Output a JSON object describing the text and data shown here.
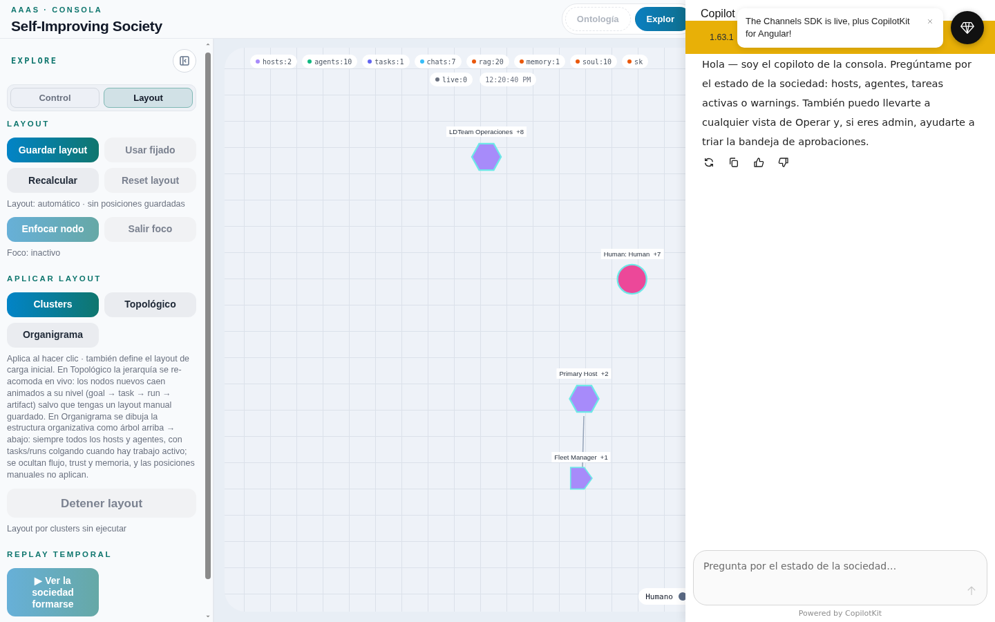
{
  "header": {
    "eyebrow": "AAAS · CONSOLA",
    "title": "Self-Improving Society"
  },
  "view_toggle": [
    {
      "label": "Ontología",
      "selected": false
    },
    {
      "label": "Explor",
      "selected": true
    }
  ],
  "sidebar": {
    "title": "EXPLORE",
    "tabs": [
      {
        "label": "Control",
        "selected": false
      },
      {
        "label": "Layout",
        "selected": true
      }
    ],
    "blocks": [
      {
        "kind": "heading",
        "text": "LAYOUT"
      },
      {
        "kind": "buttons",
        "items": [
          {
            "label": "Guardar layout",
            "kind": "primary"
          },
          {
            "label": "Usar fijado",
            "kind": "disabled"
          },
          {
            "label": "Recalcular",
            "kind": "default"
          },
          {
            "label": "Reset layout",
            "kind": "disabled"
          }
        ]
      },
      {
        "kind": "note",
        "text": "Layout: automático · sin posiciones guardadas"
      },
      {
        "kind": "buttons",
        "items": [
          {
            "label": "Enfocar nodo",
            "kind": "accent"
          },
          {
            "label": "Salir foco",
            "kind": "disabled"
          }
        ]
      },
      {
        "kind": "note",
        "text": "Foco: inactivo"
      },
      {
        "kind": "heading",
        "text": "APLICAR LAYOUT"
      },
      {
        "kind": "buttons",
        "items": [
          {
            "label": "Clusters",
            "kind": "primary"
          },
          {
            "label": "Topológico",
            "kind": "default"
          },
          {
            "label": "Organigrama",
            "kind": "default"
          }
        ]
      },
      {
        "kind": "note",
        "text": "Aplica al hacer clic · también define el layout de carga inicial. En Topológico la jerarquía se re-acomoda en vivo: los nodos nuevos caen animados a su nivel (goal → task → run → artifact) salvo que tengas un layout manual guardado. En Organigrama se dibuja la estructura organizativa como árbol arriba → abajo: siempre todos los hosts y agentes, con tasks/runs colgando cuando hay trabajo activo; se ocultan flujo, trust y memoria, y las posiciones manuales no aplican."
      },
      {
        "kind": "wide",
        "items": [
          {
            "label": "Detener layout",
            "kind": "disabled"
          }
        ]
      },
      {
        "kind": "note",
        "text": "Layout por clusters sin ejecutar"
      },
      {
        "kind": "heading",
        "text": "REPLAY TEMPORAL"
      },
      {
        "kind": "buttons",
        "items": [
          {
            "label": "▶ Ver la sociedad formarse",
            "kind": "accent"
          }
        ]
      }
    ]
  },
  "graph": {
    "counters": [
      {
        "text": "hosts:2",
        "color": "#a78bfa"
      },
      {
        "text": "agents:10",
        "color": "#10b981"
      },
      {
        "text": "tasks:1",
        "color": "#6366f1"
      },
      {
        "text": "chats:7",
        "color": "#38bdf8"
      },
      {
        "text": "rag:20",
        "color": "#ea580c"
      },
      {
        "text": "memory:1",
        "color": "#ea580c"
      },
      {
        "text": "soul:10",
        "color": "#ea580c"
      },
      {
        "text": "sk",
        "color": "#ea580c"
      }
    ],
    "live": {
      "text": "live:0",
      "color": "#6b7280"
    },
    "clock": "12:20:40 PM",
    "nodes": [
      {
        "label": "LDTeam Operaciones  +8",
        "kind": "hexagon",
        "color": "#a78bfa"
      },
      {
        "label": "Human: Human  +7",
        "kind": "circle",
        "color": "#ec4899"
      },
      {
        "label": "Primary Host  +2",
        "kind": "hexagon",
        "color": "#a78bfa",
        "children": [
          {
            "label": "Fleet Manager  +1",
            "kind": "pentagon",
            "color": "#a78bfa"
          }
        ]
      }
    ],
    "legend": {
      "label": "Humano",
      "color": "#5b6b86"
    }
  },
  "copilot": {
    "title": "Copilot",
    "version": "1.63.1",
    "toast": "The Channels SDK is live, plus CopilotKit for Angular!",
    "message": "Hola — soy el copiloto de la consola. Pregúntame por el estado de la sociedad: hosts, agentes, tareas activas o warnings. También puedo llevarte a cualquier vista de Operar y, si eres admin, ayudarte a triar la bandeja de aprobaciones.",
    "input": {
      "placeholder": "Pregunta por el estado de la sociedad…"
    },
    "footer": "Powered by CopilotKit"
  }
}
